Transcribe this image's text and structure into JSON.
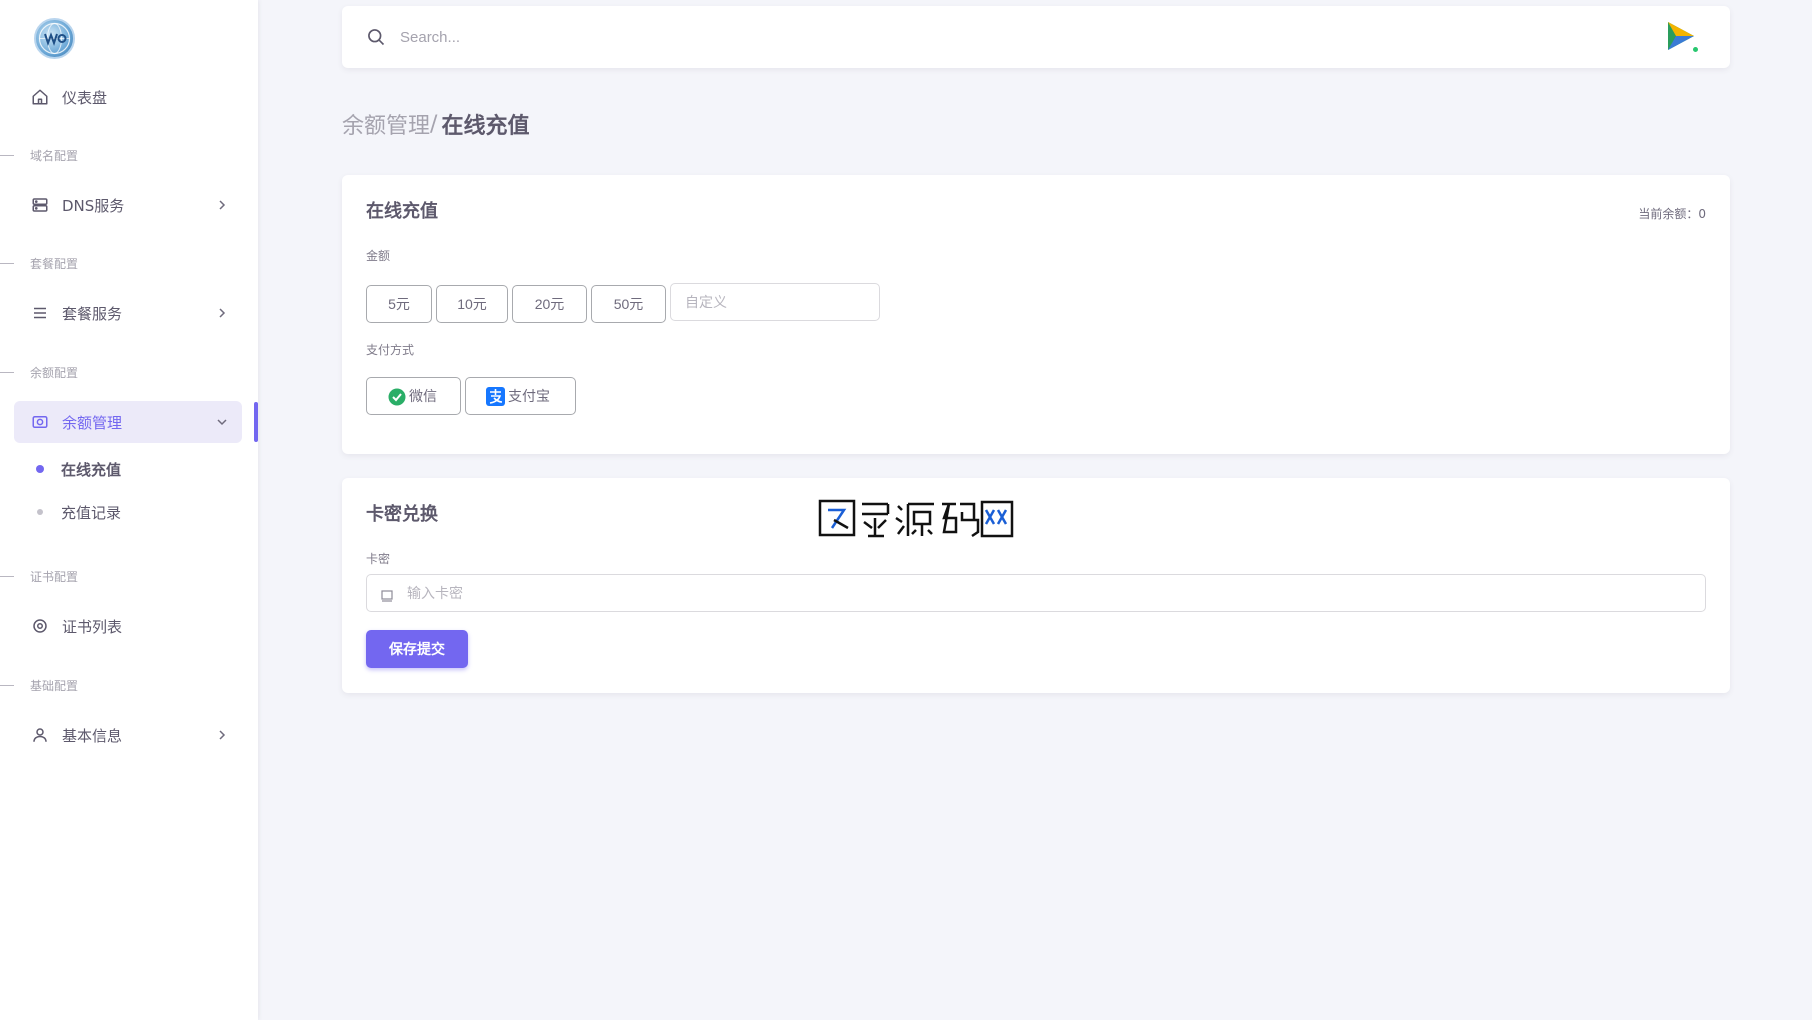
{
  "sidebar": {
    "dashboard": "仪表盘",
    "sections": {
      "domain": "域名配置",
      "package": "套餐配置",
      "balance": "余额配置",
      "cert": "证书配置",
      "basic": "基础配置"
    },
    "items": {
      "dns": "DNS服务",
      "package": "套餐服务",
      "balance": "余额管理",
      "recharge": "在线充值",
      "records": "充值记录",
      "certs": "证书列表",
      "info": "基本信息"
    }
  },
  "search": {
    "placeholder": "Search..."
  },
  "breadcrumb": {
    "parent": "余额管理",
    "separator": "/",
    "current": "在线充值"
  },
  "recharge_card": {
    "title": "在线充值",
    "balance": "当前余额：0",
    "amount_label": "金额",
    "amounts": [
      "5元",
      "10元",
      "20元",
      "50元"
    ],
    "custom_placeholder": "自定义",
    "pay_label": "支付方式",
    "pay_methods": [
      "微信",
      "支付宝"
    ]
  },
  "redeem_card": {
    "title": "卡密兑换",
    "key_label": "卡密",
    "key_placeholder": "输入卡密",
    "submit": "保存提交"
  },
  "watermark": "图录源码网",
  "colors": {
    "accent": "#7367f0",
    "background": "#f4f5fa",
    "online": "#28c76f"
  },
  "icons": [
    "home-icon",
    "server-icon",
    "menu-icon",
    "camera-icon",
    "gear-icon",
    "user-icon",
    "search-icon",
    "chevron-right-icon",
    "chevron-down-icon"
  ]
}
